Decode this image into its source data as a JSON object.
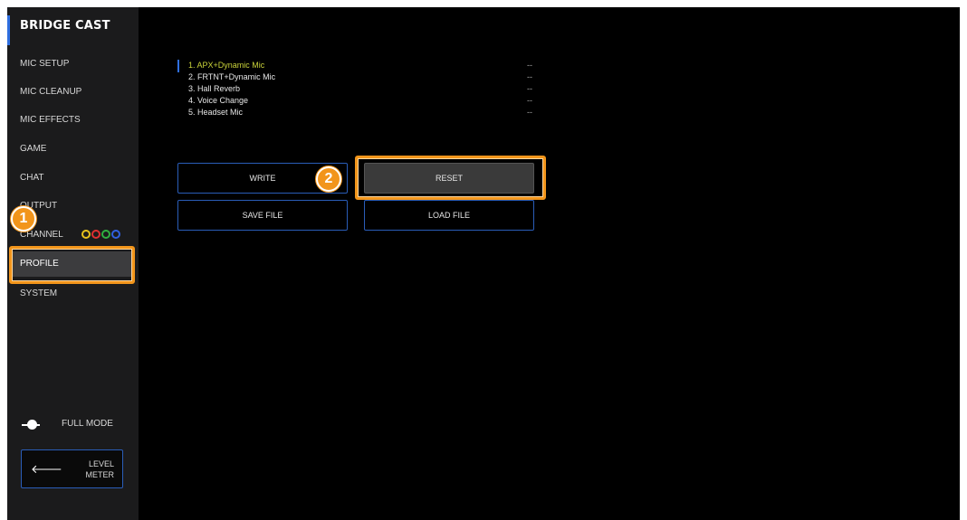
{
  "app": {
    "brand": "BRIDGE CAST"
  },
  "sidebar": {
    "items": [
      {
        "label": "MIC SETUP"
      },
      {
        "label": "MIC CLEANUP"
      },
      {
        "label": "MIC EFFECTS"
      },
      {
        "label": "GAME"
      },
      {
        "label": "CHAT"
      },
      {
        "label": "OUTPUT"
      },
      {
        "label": "CHANNEL"
      },
      {
        "label": "PROFILE",
        "active": true
      },
      {
        "label": "SYSTEM"
      }
    ],
    "channel_ring_colors": [
      "#e8c21c",
      "#e03030",
      "#30b040",
      "#3060e0"
    ],
    "full_mode_label": "FULL MODE",
    "level_meter_label_line1": "LEVEL",
    "level_meter_label_line2": "METER"
  },
  "profiles": [
    {
      "name": "1. APX+Dynamic Mic",
      "value": "--",
      "active": true
    },
    {
      "name": "2. FRTNT+Dynamic Mic",
      "value": "--"
    },
    {
      "name": "3. Hall Reverb",
      "value": "--"
    },
    {
      "name": "4. Voice Change",
      "value": "--"
    },
    {
      "name": "5. Headset Mic",
      "value": "--"
    }
  ],
  "buttons": {
    "write": "WRITE",
    "reset": "RESET",
    "save_file": "SAVE FILE",
    "load_file": "LOAD FILE"
  },
  "callouts": {
    "step1": "1",
    "step2": "2",
    "color": "#f2951b"
  }
}
